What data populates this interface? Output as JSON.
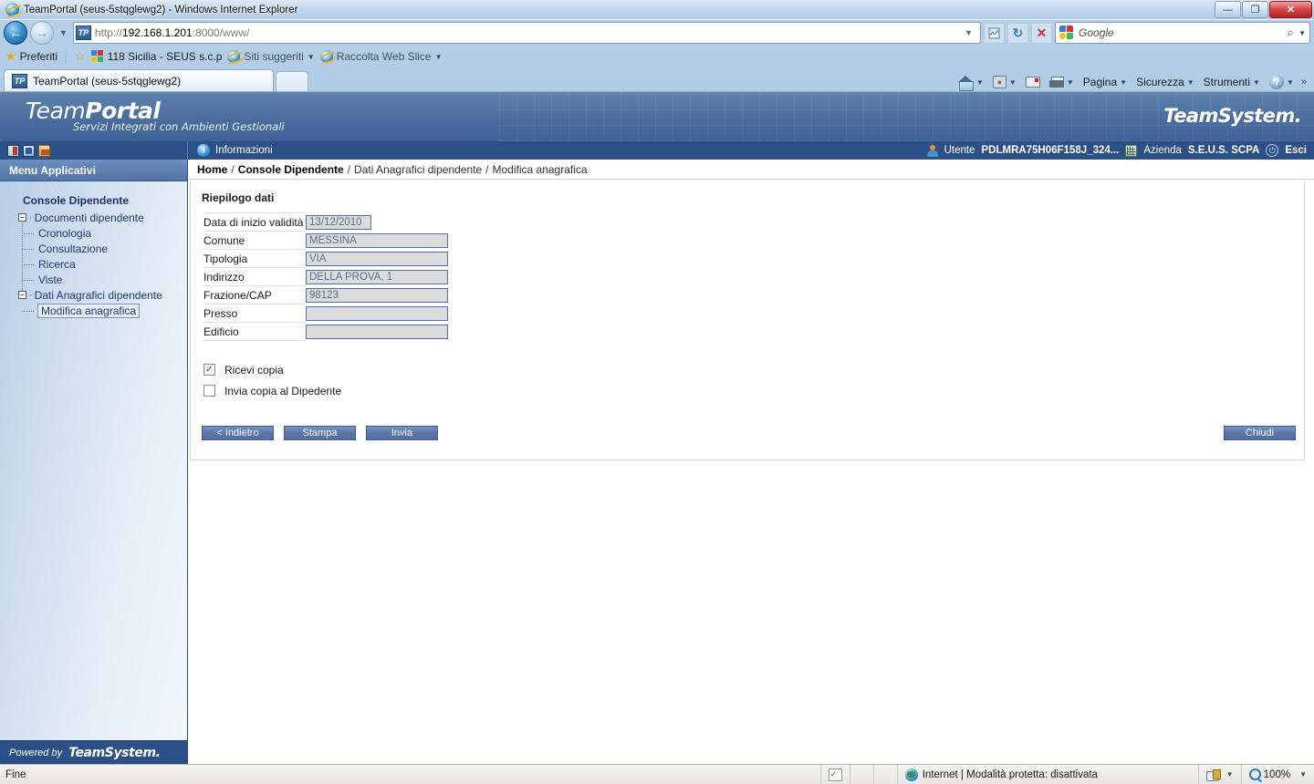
{
  "window": {
    "title": "TeamPortal (seus-5stqglewg2) - Windows Internet Explorer",
    "minimize_label": "—",
    "maximize_label": "❐",
    "close_label": "✕"
  },
  "navigation": {
    "back_label": "←",
    "forward_label": "→",
    "recent_dropdown_label": "▼",
    "url_scheme": "http://",
    "url_host": "192.168.1.201",
    "url_rest": ":8000/www/",
    "favicon_label": "TP",
    "url_dropdown_label": "▼",
    "compat_icon": "compatibility-view-icon",
    "refresh_label": "↻",
    "stop_label": "✕",
    "search_placeholder": "Google",
    "search_value": "",
    "search_dropdown_label": "▼",
    "search_go_label": "⌕"
  },
  "favorites_bar": {
    "favorites_label": "Preferiti",
    "items": [
      {
        "label": "118 Sicilia - SEUS s.c.p",
        "icon": "google-icon",
        "has_caret": false
      },
      {
        "label": "Siti suggeriti",
        "icon": "ie-icon",
        "has_caret": true
      },
      {
        "label": "Raccolta Web Slice",
        "icon": "ie-icon",
        "has_caret": true
      }
    ]
  },
  "tabs": [
    {
      "label": "TeamPortal (seus-5stqglewg2)",
      "favicon": "TP",
      "active": true
    }
  ],
  "command_bar": {
    "items": [
      {
        "label": "",
        "icon": "home-icon",
        "has_caret": true
      },
      {
        "label": "",
        "icon": "rss-feeds-icon",
        "has_caret": true
      },
      {
        "label": "",
        "icon": "mail-icon",
        "has_caret": false
      },
      {
        "label": "",
        "icon": "print-icon",
        "has_caret": true
      },
      {
        "label": "Pagina",
        "icon": "",
        "has_caret": true
      },
      {
        "label": "Sicurezza",
        "icon": "",
        "has_caret": true
      },
      {
        "label": "Strumenti",
        "icon": "",
        "has_caret": true
      },
      {
        "label": "",
        "icon": "help-icon",
        "has_caret": true
      }
    ],
    "overflow_label": "»"
  },
  "banner": {
    "logo_team": "Team",
    "logo_portal": "Portal",
    "tagline": "Servizi Integrati con Ambienti Gestionali",
    "brand_right": "TeamSystem."
  },
  "utility_bar": {
    "left_icons": [
      "exit-door-icon",
      "back-arrow-icon",
      "home-icon"
    ],
    "info_label": "Informazioni",
    "user_prefix": "Utente",
    "user_value": "PDLMRA75H06F158J_324...",
    "company_prefix": "Azienda",
    "company_value": "S.E.U.S. SCPA",
    "logout_label": "Esci"
  },
  "sidebar": {
    "header": "Menu Applicativi",
    "tree_root": "Console Dipendente",
    "groups": [
      {
        "label": "Documenti dipendente",
        "expander": "−",
        "children": [
          {
            "label": "Cronologia",
            "selected": false
          },
          {
            "label": "Consultazione",
            "selected": false
          },
          {
            "label": "Ricerca",
            "selected": false
          },
          {
            "label": "Viste",
            "selected": false
          }
        ]
      },
      {
        "label": "Dati Anagrafici dipendente",
        "expander": "−",
        "children": [
          {
            "label": "Modifica anagrafica",
            "selected": true
          }
        ]
      }
    ],
    "footer_powered": "Powered by",
    "footer_brand": "TeamSystem."
  },
  "breadcrumb": {
    "items": [
      "Home",
      "Console Dipendente",
      "Dati Anagrafici dipendente",
      "Modifica anagrafica"
    ],
    "separator": "/"
  },
  "panel": {
    "title": "Riepilogo dati",
    "fields": [
      {
        "label": "Data di inizio validità",
        "value": "13/12/2010",
        "width": "date"
      },
      {
        "label": "Comune",
        "value": "MESSINA",
        "width": "full"
      },
      {
        "label": "Tipologia",
        "value": "VIA",
        "width": "full"
      },
      {
        "label": "Indirizzo",
        "value": "DELLA PROVA, 1",
        "width": "full"
      },
      {
        "label": "Frazione/CAP",
        "value": "98123",
        "width": "full"
      },
      {
        "label": "Presso",
        "value": "",
        "width": "full"
      },
      {
        "label": "Edificio",
        "value": "",
        "width": "full"
      }
    ],
    "checkboxes": [
      {
        "label": "Ricevi copia",
        "checked": true,
        "mark": "✓"
      },
      {
        "label": "Invia copia al Dipedente",
        "checked": false,
        "mark": ""
      }
    ],
    "buttons": [
      {
        "label": "< Indietro",
        "align": "left"
      },
      {
        "label": "Stampa",
        "align": "left"
      },
      {
        "label": "Invia",
        "align": "left"
      },
      {
        "label": "Chiudi",
        "align": "right"
      }
    ]
  },
  "status_bar": {
    "message": "Fine",
    "zone": "Internet | Modalità protetta: disattivata",
    "zoom_level": "100%",
    "zoom_caret": "▼",
    "privacy_caret": "▼"
  },
  "colors": {
    "brand_blue": "#2b4f87",
    "banner_blue": "#4a6d9e",
    "button_blue": "#5b77aa",
    "field_bg": "#dcdcdc",
    "field_border": "#4f6f9e",
    "link_text": "#1f3c6e"
  }
}
